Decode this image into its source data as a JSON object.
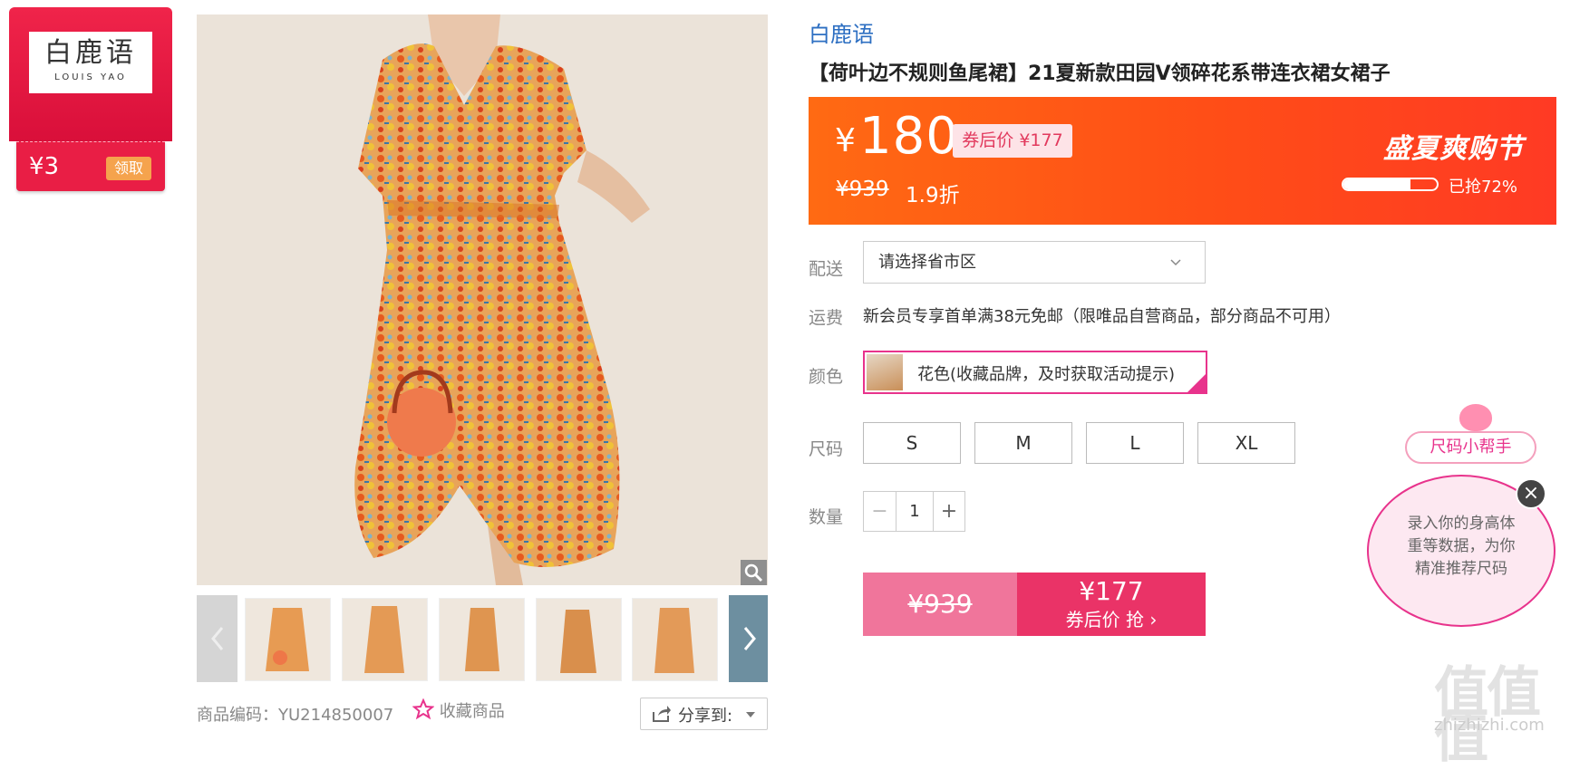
{
  "coupon": {
    "brand_cn": "白鹿语",
    "brand_en": "LOUIS YAO",
    "amount": "¥3",
    "claim_label": "领取"
  },
  "gallery": {
    "thumb_count": 6
  },
  "product_code_label": "商品编码：YU214850007",
  "favorite_label": "收藏商品",
  "share_label": "分享到:",
  "brand": "白鹿语",
  "title": "【荷叶边不规则鱼尾裙】21夏新款田园V领碎花系带连衣裙女裙子",
  "price": {
    "currency": "¥",
    "current": "180",
    "after_coupon": "券后价 ¥177",
    "original": "¥939",
    "discount": "1.9折",
    "promo_title": "盛夏爽购节",
    "sold_label": "已抢72%",
    "sold_fraction": 0.72
  },
  "delivery": {
    "label": "配送",
    "placeholder": "请选择省市区"
  },
  "shipping": {
    "label": "运费",
    "text": "新会员专享首单满38元免邮（限唯品自营商品，部分商品不可用）"
  },
  "color": {
    "label": "颜色",
    "option": "花色(收藏品牌，及时获取活动提示)"
  },
  "size": {
    "label": "尺码",
    "options": [
      "S",
      "M",
      "L",
      "XL"
    ]
  },
  "quantity": {
    "label": "数量",
    "minus": "−",
    "value": "1",
    "plus": "+"
  },
  "buy": {
    "original": "¥939",
    "price": "¥177",
    "action": "券后价 抢 ›"
  },
  "size_helper": {
    "tag": "尺码小帮手",
    "text_line1": "录入你的身高体",
    "text_line2": "重等数据，为你",
    "text_line3": "精准推荐尺码",
    "close": "×"
  },
  "watermark": {
    "main": "值值值",
    "sub": "zhizhizhi.com"
  },
  "colors": {
    "accent_pink": "#e8338c",
    "price_orange": "#ff5a16",
    "brand_blue": "#2d6fc2"
  }
}
